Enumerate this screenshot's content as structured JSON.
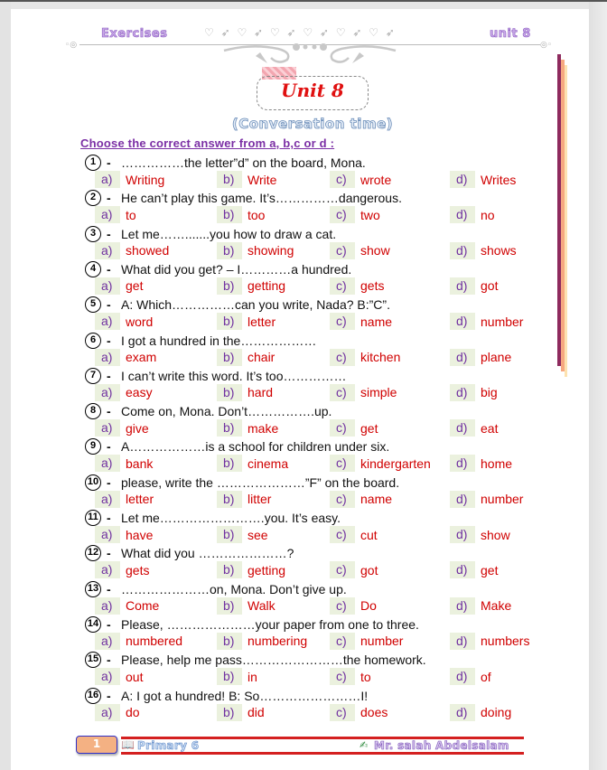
{
  "header": {
    "left": "Exercises",
    "right": "unit 8",
    "ornament": "♡ ➶  ♡ ➶  ♡ ➶  ♡ ➶  ♡ ➶ ♡ ➶"
  },
  "title": "Unit 8",
  "subtitle": "(Conversation time)",
  "instruction": "Choose the correct answer from a, b,c or d :",
  "questions": [
    {
      "num": "1",
      "text": "……………the letter”d” on the board, Mona.",
      "options": [
        "Writing",
        "Write",
        "wrote",
        "Writes"
      ]
    },
    {
      "num": "2",
      "text": "He can’t play this game. It’s……………dangerous.",
      "options": [
        "to",
        "too",
        "two",
        "no"
      ]
    },
    {
      "num": "3",
      "text": "Let me…….......you how to draw a cat.",
      "options": [
        "showed",
        "showing",
        "show",
        "shows"
      ]
    },
    {
      "num": "4",
      "text": "What did you get? – I…………a hundred.",
      "options": [
        "get",
        "getting",
        "gets",
        "got"
      ]
    },
    {
      "num": "5",
      "text": "A: Which……………can you write, Nada? B:”C”.",
      "options": [
        "word",
        "letter",
        "name",
        "number"
      ]
    },
    {
      "num": "6",
      "text": "I got a hundred in the………………",
      "options": [
        "exam",
        "chair",
        "kitchen",
        "plane"
      ]
    },
    {
      "num": "7",
      "text": "I can’t write this word. It’s too……………",
      "options": [
        "easy",
        "hard",
        "simple",
        "big"
      ]
    },
    {
      "num": "8",
      "text": "Come on, Mona. Don’t…………….up.",
      "options": [
        "give",
        "make",
        "get",
        "eat"
      ]
    },
    {
      "num": "9",
      "text": "A………………is a school for children  under six.",
      "options": [
        "bank",
        "cinema",
        "kindergarten",
        "home"
      ]
    },
    {
      "num": "10",
      "text": "please, write the …………………”F” on the board.",
      "options": [
        "letter",
        "litter",
        "name",
        "number"
      ]
    },
    {
      "num": "11",
      "text": "Let me…………………….you. It’s easy.",
      "options": [
        "have",
        "see",
        "cut",
        "show"
      ]
    },
    {
      "num": "12",
      "text": "What did you …………………?",
      "options": [
        "gets",
        "getting",
        "got",
        "get"
      ]
    },
    {
      "num": "13",
      "text": "…………………on, Mona. Don’t give up.",
      "options": [
        "Come",
        "Walk",
        "Do",
        "Make"
      ]
    },
    {
      "num": "14",
      "text": "Please, …………………your paper from one to three.",
      "options": [
        "numbered",
        "numbering",
        "number",
        "numbers"
      ]
    },
    {
      "num": "15",
      "text": "Please, help me pass……………………the homework.",
      "options": [
        "out",
        "in",
        "to",
        "of"
      ]
    },
    {
      "num": "16",
      "text": "A: I got a hundred! B: So……………………I!",
      "options": [
        "do",
        "did",
        "does",
        "doing"
      ]
    }
  ],
  "option_letters": [
    "a)",
    "b)",
    "c)",
    "d)"
  ],
  "footer": {
    "page_number": "1",
    "book_icon": "📖",
    "left": "Primary 6",
    "pen_icon": "✍",
    "right": "Mr. salah Abdelsalam"
  }
}
